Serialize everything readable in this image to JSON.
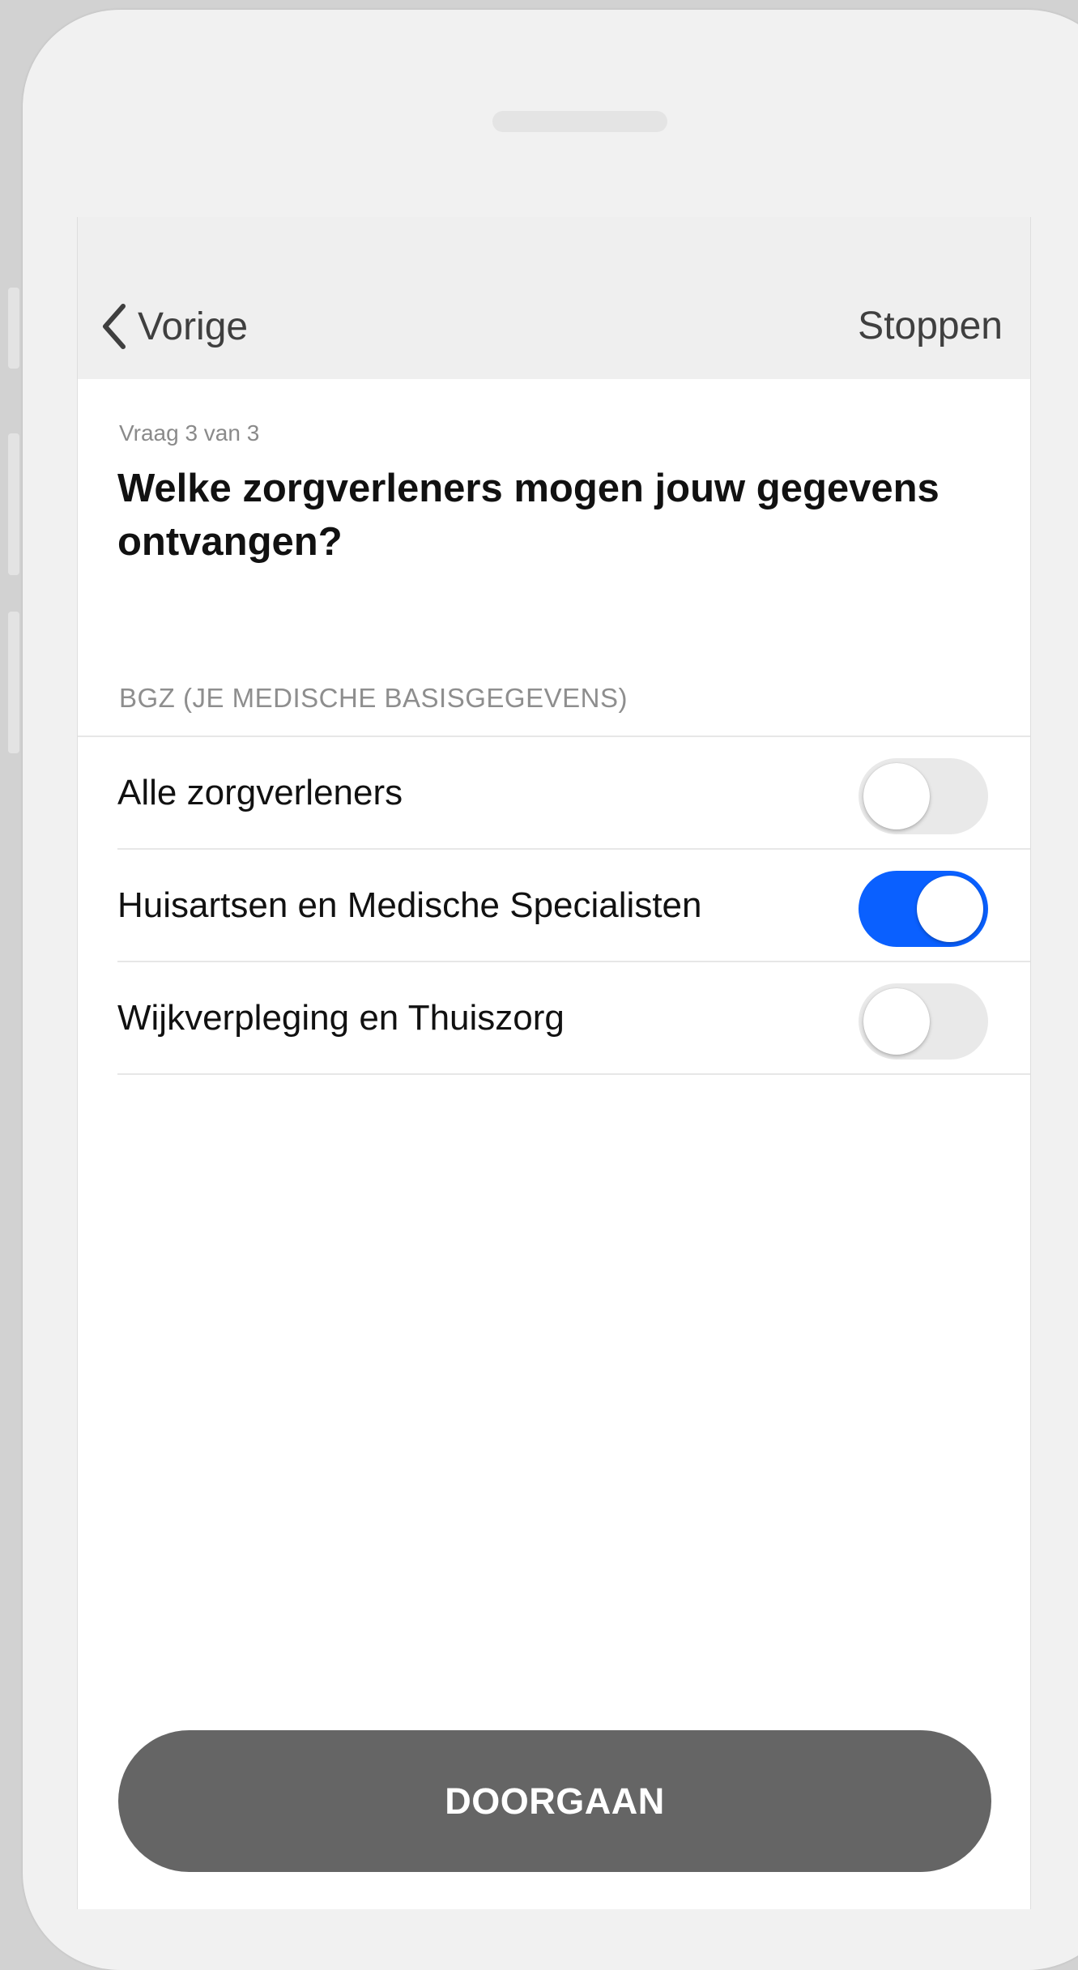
{
  "nav": {
    "back_label": "Vorige",
    "stop_label": "Stoppen"
  },
  "question": {
    "step": "Vraag 3 van 3",
    "title": "Welke zorgverleners mogen jouw gegevens ontvangen?"
  },
  "section": {
    "header": "BGZ (JE MEDISCHE BASISGEGEVENS)",
    "items": [
      {
        "label": "Alle zorgverleners",
        "enabled": false
      },
      {
        "label": "Huisartsen en Medische Specialisten",
        "enabled": true
      },
      {
        "label": "Wijkverpleging en Thuiszorg",
        "enabled": false
      }
    ]
  },
  "primary_button": {
    "label": "DOORGAAN"
  },
  "colors": {
    "toggle_on": "#0a60ff",
    "toggle_off": "#e9e9e9",
    "button_bg": "#656565"
  },
  "icons": {
    "back": "chevron-left-icon"
  }
}
